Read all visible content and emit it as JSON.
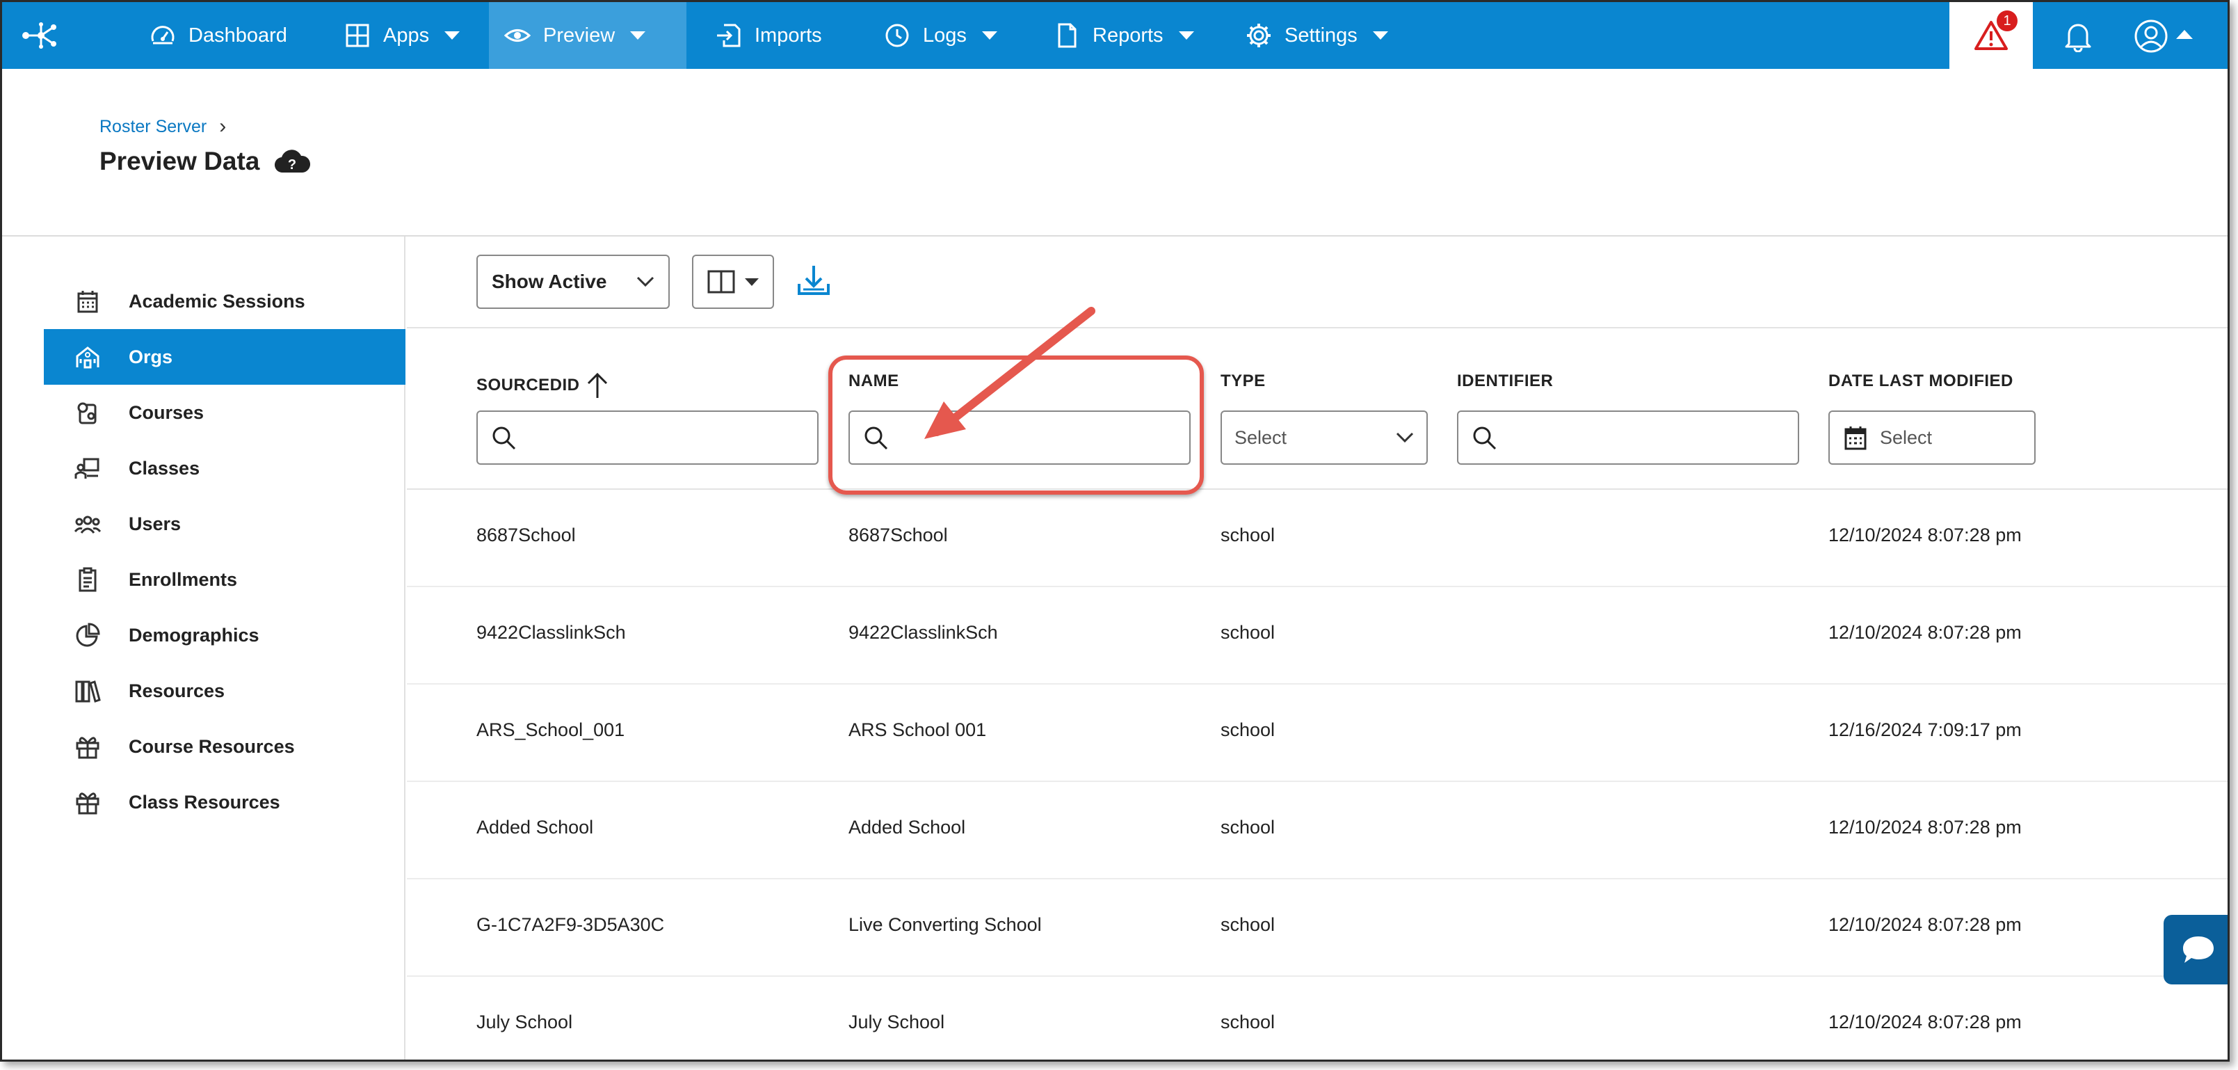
{
  "nav": {
    "items": [
      {
        "label": "Dashboard",
        "icon": "gauge-icon"
      },
      {
        "label": "Apps",
        "icon": "grid-icon"
      },
      {
        "label": "Preview",
        "icon": "eye-icon"
      },
      {
        "label": "Imports",
        "icon": "import-icon"
      },
      {
        "label": "Logs",
        "icon": "clock-icon"
      },
      {
        "label": "Reports",
        "icon": "document-icon"
      },
      {
        "label": "Settings",
        "icon": "gear-icon"
      }
    ],
    "alert_count": "1"
  },
  "breadcrumb": {
    "parent": "Roster Server"
  },
  "page": {
    "title": "Preview Data"
  },
  "sidebar": {
    "items": [
      {
        "label": "Academic Sessions"
      },
      {
        "label": "Orgs"
      },
      {
        "label": "Courses"
      },
      {
        "label": "Classes"
      },
      {
        "label": "Users"
      },
      {
        "label": "Enrollments"
      },
      {
        "label": "Demographics"
      },
      {
        "label": "Resources"
      },
      {
        "label": "Course Resources"
      },
      {
        "label": "Class Resources"
      }
    ]
  },
  "toolbar": {
    "status_select": "Show Active"
  },
  "table": {
    "columns": [
      "SOURCEDID",
      "NAME",
      "TYPE",
      "IDENTIFIER",
      "DATE LAST MODIFIED"
    ],
    "type_placeholder": "Select",
    "date_placeholder": "Select",
    "rows": [
      {
        "sourcedid": "8687School",
        "name": "8687School",
        "type": "school",
        "identifier": "",
        "modified": "12/10/2024 8:07:28 pm"
      },
      {
        "sourcedid": "9422ClasslinkSch",
        "name": "9422ClasslinkSch",
        "type": "school",
        "identifier": "",
        "modified": "12/10/2024 8:07:28 pm"
      },
      {
        "sourcedid": "ARS_School_001",
        "name": "ARS School 001",
        "type": "school",
        "identifier": "",
        "modified": "12/16/2024 7:09:17 pm"
      },
      {
        "sourcedid": "Added School",
        "name": "Added School",
        "type": "school",
        "identifier": "",
        "modified": "12/10/2024 8:07:28 pm"
      },
      {
        "sourcedid": "G-1C7A2F9-3D5A30C",
        "name": "Live Converting School",
        "type": "school",
        "identifier": "",
        "modified": "12/10/2024 8:07:28 pm"
      },
      {
        "sourcedid": "July School",
        "name": "July School",
        "type": "school",
        "identifier": "",
        "modified": "12/10/2024 8:07:28 pm"
      }
    ]
  },
  "colors": {
    "primary": "#0a86d0",
    "highlight": "#e5584e",
    "alert": "#d81e1e"
  }
}
